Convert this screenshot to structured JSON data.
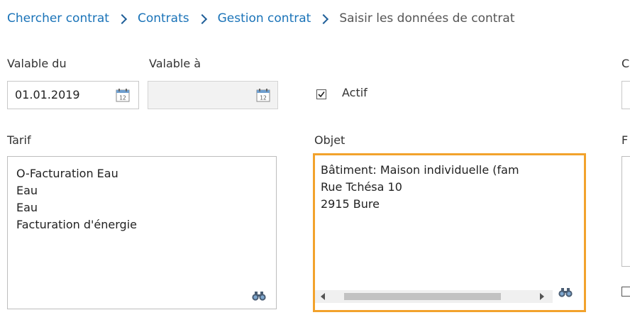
{
  "breadcrumb": {
    "items": [
      "Chercher contrat",
      "Contrats",
      "Gestion contrat"
    ],
    "current": "Saisir les données de contrat"
  },
  "form": {
    "valid_from": {
      "label": "Valable du",
      "value": "01.01.2019"
    },
    "valid_to": {
      "label": "Valable à",
      "value": ""
    },
    "active": {
      "label": "Actif",
      "checked": true
    },
    "tarif": {
      "label": "Tarif",
      "lines": [
        "O-Facturation Eau",
        "Eau",
        "Eau",
        "Facturation d'énergie"
      ]
    },
    "objet": {
      "label": "Objet",
      "lines": [
        "Bâtiment: Maison individuelle (fam",
        "Rue Tchésa 10",
        "2915 Bure"
      ]
    },
    "right_col_label_1": "C",
    "right_col_label_2": "F"
  },
  "icons": {
    "calendar": "calendar-icon",
    "binoculars": "binoculars-icon",
    "check": "checkmark-icon"
  },
  "colors": {
    "link": "#1a73b8",
    "separator": "#1f5f99",
    "focus_border": "#f2a22c"
  }
}
